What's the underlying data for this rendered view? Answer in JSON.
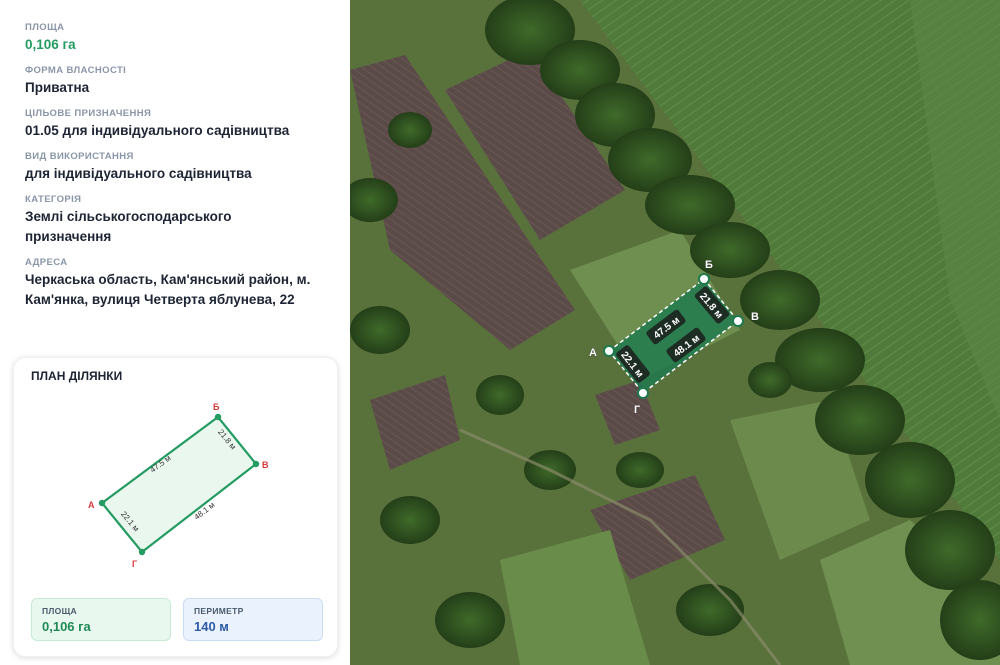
{
  "info": {
    "area_label": "ПЛОЩА",
    "area_value": "0,106 га",
    "ownership_label": "ФОРМА ВЛАСНОСТІ",
    "ownership_value": "Приватна",
    "purpose_label": "ЦІЛЬОВЕ ПРИЗНАЧЕННЯ",
    "purpose_value": "01.05 для індивідуального садівництва",
    "usage_label": "ВИД ВИКОРИСТАННЯ",
    "usage_value": "для індивідуального садівництва",
    "category_label": "КАТЕГОРІЯ",
    "category_line1": "Землі сільськогосподарського",
    "category_line2": "призначення",
    "address_label": "АДРЕСА",
    "address_line1": "Черкаська область, Кам'янський район, м.",
    "address_line2": "Кам'янка, вулиця Четверта яблунева, 22"
  },
  "plan": {
    "title": "ПЛАН ДІЛЯНКИ",
    "vertices": [
      "А",
      "Б",
      "В",
      "Г"
    ],
    "sides": {
      "ab": "47.5 м",
      "bv": "21.8 м",
      "vg": "48.1 м",
      "ga": "22.1 м"
    },
    "area_label": "ПЛОЩА",
    "area_value": "0,106 га",
    "perimeter_label": "ПЕРИМЕТР",
    "perimeter_value": "140 м"
  },
  "colors": {
    "accent_green": "#239b61",
    "vertex_red": "#d63a3a",
    "parcel_fill": "#1f7a4f"
  }
}
